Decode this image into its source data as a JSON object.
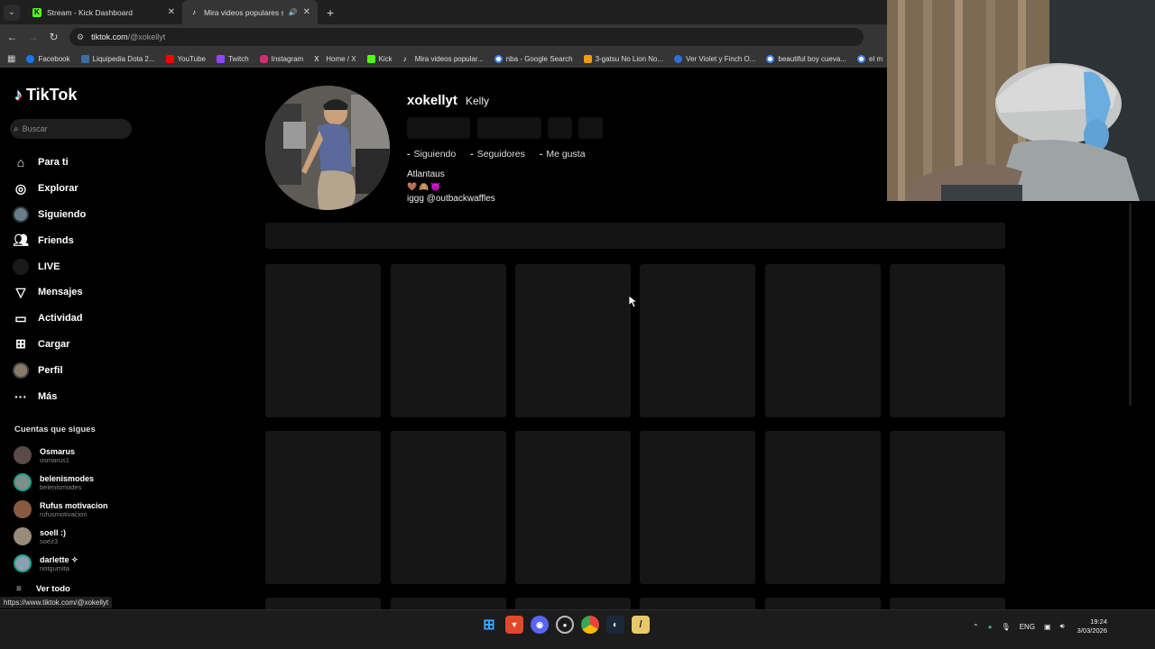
{
  "browser": {
    "tabs": [
      {
        "label": "Stream - Kick Dashboard",
        "icon": "kick-icon",
        "color": "#53fc18"
      },
      {
        "label": "Mira videos populares sele",
        "icon": "tiktok-icon",
        "color": "#ffffff"
      }
    ],
    "url_host": "tiktok.com",
    "url_path": "/@xokellyt",
    "bookmarks": [
      {
        "label": "Facebook",
        "color": "#1877f2"
      },
      {
        "label": "Liquipedia Dota 2...",
        "color": "#3a6ea5"
      },
      {
        "label": "YouTube",
        "color": "#ff0000"
      },
      {
        "label": "Twitch",
        "color": "#9146ff"
      },
      {
        "label": "Instagram",
        "color": "#d62976"
      },
      {
        "label": "Home / X",
        "color": "#ffffff"
      },
      {
        "label": "Kick",
        "color": "#53fc18"
      },
      {
        "label": "Mira videos popular...",
        "color": "#ffffff"
      },
      {
        "label": "nba - Google Search",
        "color": "#4285f4"
      },
      {
        "label": "3-gatsu No Lion No...",
        "color": "#f39c12"
      },
      {
        "label": "Ver Violet y Finch O...",
        "color": "#2f6fd6"
      },
      {
        "label": "beautiful boy cueva...",
        "color": "#4285f4"
      },
      {
        "label": "el m",
        "color": "#4285f4"
      }
    ],
    "status_link": "https://www.tiktok.com/@xokellyt"
  },
  "sidebar": {
    "logo": "TikTok",
    "search_placeholder": "Buscar",
    "nav": [
      {
        "label": "Para ti",
        "icon": "home-icon"
      },
      {
        "label": "Explorar",
        "icon": "compass-icon"
      },
      {
        "label": "Siguiendo",
        "icon": "following-avatar-icon"
      },
      {
        "label": "Friends",
        "icon": "friends-icon"
      },
      {
        "label": "LIVE",
        "icon": "live-icon"
      },
      {
        "label": "Mensajes",
        "icon": "messages-icon"
      },
      {
        "label": "Actividad",
        "icon": "activity-icon"
      },
      {
        "label": "Cargar",
        "icon": "upload-icon"
      },
      {
        "label": "Perfil",
        "icon": "profile-avatar-icon"
      },
      {
        "label": "Más",
        "icon": "more-icon"
      }
    ],
    "following_title": "Cuentas que sigues",
    "following": [
      {
        "name": "Osmarus",
        "user": "osmarus1",
        "color": "#5a4a48"
      },
      {
        "name": "belenismodes",
        "user": "belenismodes",
        "color": "#7d8f86"
      },
      {
        "name": "Rufus motivacion",
        "user": "rufusmotivacion",
        "color": "#8a5a40"
      },
      {
        "name": "soell :)",
        "user": "soez3",
        "color": "#9a8a7a"
      },
      {
        "name": "darlette ✧",
        "user": "notgumita",
        "color": "#8aa0b0"
      }
    ],
    "see_all": "Ver todo"
  },
  "profile": {
    "username": "xokellyt",
    "nickname": "Kelly",
    "stats": [
      {
        "value": "-",
        "label": "Siguiendo"
      },
      {
        "value": "-",
        "label": "Seguidores"
      },
      {
        "value": "-",
        "label": "Me gusta"
      }
    ],
    "bio_line1": "Atlantaus",
    "bio_emoji": "🤎🙈😈",
    "bio_line3": "iggg @outbackwaffles"
  },
  "taskbar": {
    "lang": "ENG",
    "time": "19:24",
    "date": "3/03/2026",
    "apps": [
      "windows-start-icon",
      "brave-icon",
      "discord-icon",
      "obs-icon",
      "chrome-icon",
      "steam-icon",
      "dota-icon"
    ]
  }
}
